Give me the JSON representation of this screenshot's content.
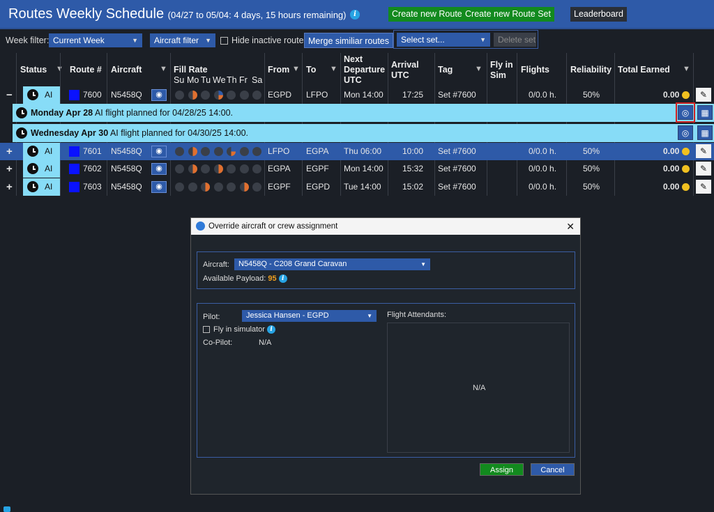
{
  "header": {
    "title": "Routes Weekly Schedule",
    "subtitle": "(04/27 to 05/04: 4 days, 15 hours remaining)",
    "buttons": {
      "new_route": "Create new Route",
      "new_route_set": "Create new Route Set",
      "leaderboard": "Leaderboard"
    }
  },
  "toolbar": {
    "week_filter_label": "Week filter:",
    "week_filter_value": "Current Week",
    "aircraft_filter": "Aircraft filter",
    "hide_inactive": "Hide inactive routes",
    "merge": "Merge similiar routes",
    "select_set": "Select set...",
    "delete_set": "Delete set"
  },
  "columns": {
    "status": "Status",
    "route": "Route #",
    "aircraft": "Aircraft",
    "fill_rate": "Fill Rate",
    "days": [
      "Su",
      "Mo",
      "Tu",
      "We",
      "Th",
      "Fr",
      "Sa"
    ],
    "from": "From",
    "to": "To",
    "next_dep": [
      "Next",
      "Departure",
      "UTC"
    ],
    "arrival": [
      "Arrival",
      "UTC"
    ],
    "tag": "Tag",
    "fly_sim": [
      "Fly in",
      "Sim"
    ],
    "flights": "Flights",
    "reliability": "Reliability",
    "total_earned": "Total Earned"
  },
  "rows": [
    {
      "toggle": "−",
      "status": "AI",
      "route": "7600",
      "aircraft": "N5458Q",
      "fill": [
        "e",
        "h",
        "e",
        "q",
        "e",
        "e",
        "e"
      ],
      "from": "EGPD",
      "to": "LFPO",
      "dep": "Mon 14:00",
      "arr": "17:25",
      "tag": "Set #7600",
      "flights": "0/0.0 h.",
      "reliability": "50%",
      "earned": "0.00"
    },
    {
      "toggle": "+",
      "status": "AI",
      "route": "7601",
      "aircraft": "N5458Q",
      "fill": [
        "e",
        "h",
        "e",
        "e",
        "q",
        "e",
        "e"
      ],
      "from": "LFPO",
      "to": "EGPA",
      "dep": "Thu 06:00",
      "arr": "10:00",
      "tag": "Set #7600",
      "flights": "0/0.0 h.",
      "reliability": "50%",
      "earned": "0.00"
    },
    {
      "toggle": "+",
      "status": "AI",
      "route": "7602",
      "aircraft": "N5458Q",
      "fill": [
        "e",
        "h",
        "e",
        "h",
        "e",
        "e",
        "e"
      ],
      "from": "EGPA",
      "to": "EGPF",
      "dep": "Mon 14:00",
      "arr": "15:32",
      "tag": "Set #7600",
      "flights": "0/0.0 h.",
      "reliability": "50%",
      "earned": "0.00"
    },
    {
      "toggle": "+",
      "status": "AI",
      "route": "7603",
      "aircraft": "N5458Q",
      "fill": [
        "e",
        "e",
        "h",
        "e",
        "e",
        "h",
        "e"
      ],
      "from": "EGPF",
      "to": "EGPD",
      "dep": "Tue 14:00",
      "arr": "15:02",
      "tag": "Set #7600",
      "flights": "0/0.0 h.",
      "reliability": "50%",
      "earned": "0.00"
    }
  ],
  "subrows": [
    {
      "day": "Monday Apr 28",
      "text": "AI flight planned for 04/28/25 14:00."
    },
    {
      "day": "Wednesday Apr 30",
      "text": "AI flight planned for 04/30/25 14:00."
    }
  ],
  "modal": {
    "title": "Override aircraft or crew assignment",
    "aircraft_label": "Aircraft:",
    "aircraft_value": "N5458Q - C208 Grand Caravan",
    "payload_label": "Available Payload:",
    "payload_value": "95",
    "pilot_label": "Pilot:",
    "pilot_value": "Jessica Hansen - EGPD",
    "fly_sim": "Fly in simulator",
    "copilot_label": "Co-Pilot:",
    "copilot_value": "N/A",
    "fa_label": "Flight Attendants:",
    "fa_value": "N/A",
    "assign": "Assign",
    "cancel": "Cancel"
  },
  "colors": {
    "header": "#2e5aa8",
    "selected_row": "#2e5aa8",
    "status_bg": "#87dcf7",
    "green": "#128a1e",
    "coin": "#f0c020",
    "route_color": "#0a12ff"
  }
}
